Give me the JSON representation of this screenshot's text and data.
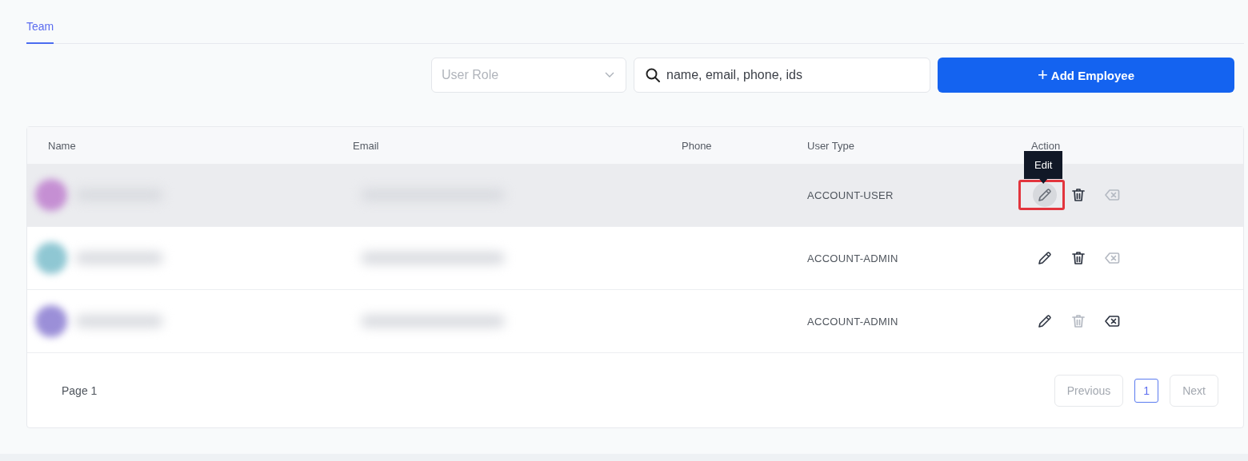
{
  "tabs": [
    {
      "label": "Team",
      "selected": true
    }
  ],
  "toolbar": {
    "role_select": {
      "placeholder": "User Role"
    },
    "search": {
      "placeholder": "name, email, phone, ids"
    },
    "add_button": {
      "icon": "+",
      "label": "Add Employee"
    }
  },
  "table": {
    "columns": [
      "Name",
      "Email",
      "Phone",
      "User Type",
      "Action"
    ],
    "rows": [
      {
        "color": "#c58fd3",
        "user_type": "ACCOUNT-USER",
        "hovered": true,
        "tooltip": "Edit",
        "actions": [
          {
            "kind": "edit",
            "disabled": false,
            "hovered": true,
            "highlighted": true
          },
          {
            "kind": "delete",
            "disabled": false
          },
          {
            "kind": "remove",
            "disabled": true
          }
        ]
      },
      {
        "color": "#8fc7d3",
        "user_type": "ACCOUNT-ADMIN",
        "hovered": false,
        "actions": [
          {
            "kind": "edit",
            "disabled": false
          },
          {
            "kind": "delete",
            "disabled": false
          },
          {
            "kind": "remove",
            "disabled": true
          }
        ]
      },
      {
        "color": "#9b8fd8",
        "user_type": "ACCOUNT-ADMIN",
        "hovered": false,
        "actions": [
          {
            "kind": "edit",
            "disabled": false
          },
          {
            "kind": "delete",
            "disabled": true
          },
          {
            "kind": "remove",
            "disabled": false
          }
        ]
      }
    ]
  },
  "footer": {
    "page_label": "Page 1",
    "pagination": [
      {
        "label": "Previous",
        "kind": "nav",
        "selected": false
      },
      {
        "label": "1",
        "kind": "page",
        "selected": true
      },
      {
        "label": "Next",
        "kind": "nav",
        "selected": false
      }
    ]
  }
}
